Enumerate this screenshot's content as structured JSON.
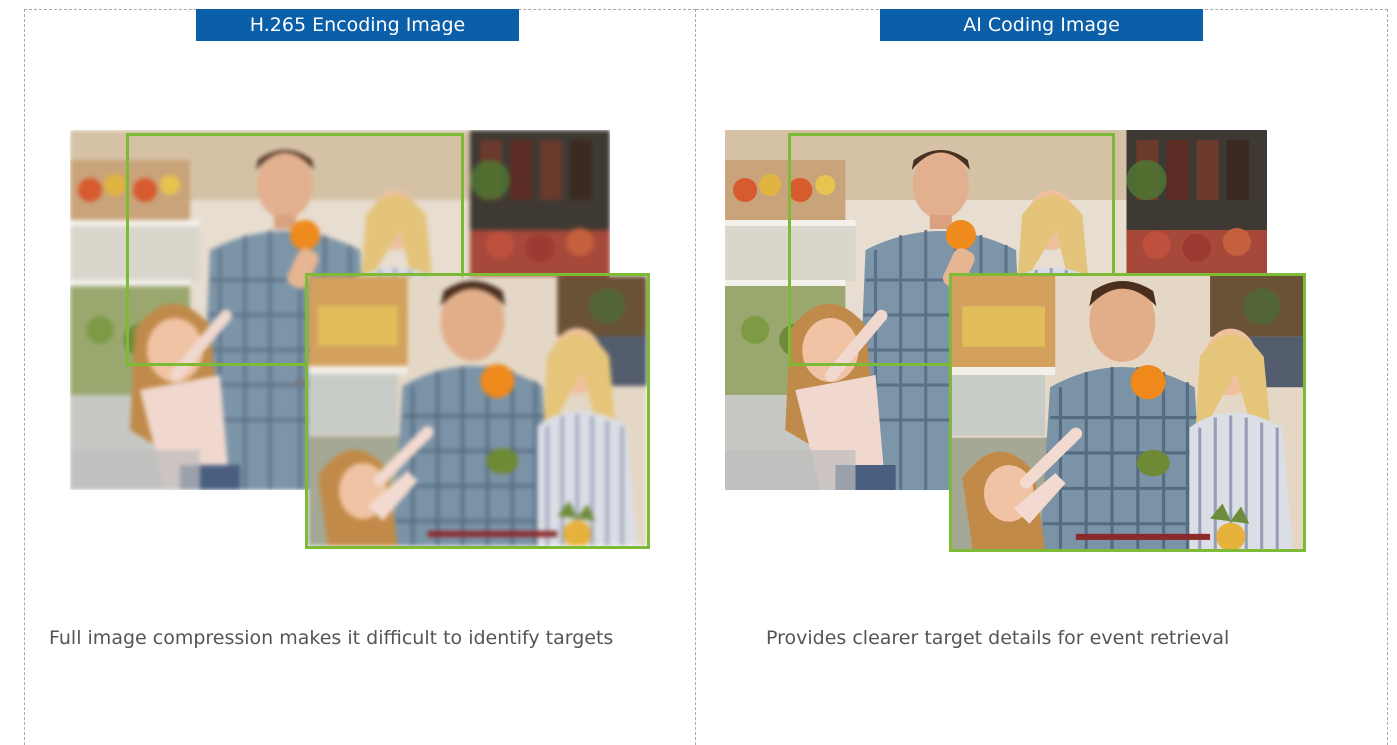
{
  "panels": [
    {
      "id": "left",
      "title": "H.265 Encoding Image",
      "caption": "Full image compression makes it difficult to identify targets"
    },
    {
      "id": "right",
      "title": "AI Coding Image",
      "caption": "Provides clearer target details for event retrieval"
    }
  ],
  "colors": {
    "title_bar": "#0b5ea8",
    "title_text": "#ffffff",
    "frame": "#7dbb36",
    "caption": "#555555",
    "divider": "#a9a9a9"
  },
  "image": {
    "subject": "family-shopping-photo"
  }
}
